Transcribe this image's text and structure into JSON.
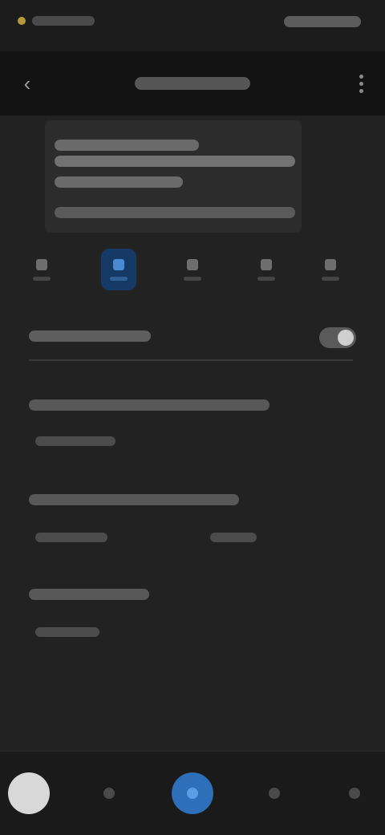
{
  "status_bar": {
    "time": "",
    "indicators": ""
  },
  "header": {
    "title": "",
    "back_icon": "back-arrow-icon",
    "menu_icon": "more-vert-icon"
  },
  "info_card": {
    "text": ""
  },
  "icon_row": {
    "items": [
      {
        "icon": "text-icon"
      },
      {
        "icon": "highlight-icon",
        "selected": true
      },
      {
        "icon": "list-icon"
      },
      {
        "icon": "image-icon"
      },
      {
        "icon": "more-icon"
      }
    ],
    "accent": "#2d6fb8"
  },
  "settings": {
    "toggle": {
      "label": "",
      "value": true
    },
    "section_a": {
      "label": "",
      "value": ""
    },
    "section_b": {
      "label": "",
      "left": "",
      "right": ""
    },
    "section_c": {
      "label": "",
      "value": ""
    }
  },
  "bottom_nav": {
    "items": [
      {
        "icon": "profile-icon"
      },
      {
        "icon": "nav-icon-2"
      },
      {
        "icon": "primary-action-icon"
      },
      {
        "icon": "nav-icon-4"
      },
      {
        "icon": "nav-icon-5"
      }
    ]
  }
}
